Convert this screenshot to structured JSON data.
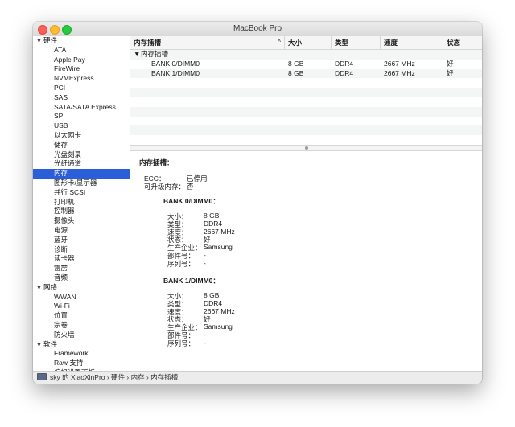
{
  "window": {
    "title": "MacBook Pro"
  },
  "sidebar": {
    "hardware": {
      "label": "硬件",
      "items": [
        "ATA",
        "Apple Pay",
        "FireWire",
        "NVMExpress",
        "PCI",
        "SAS",
        "SATA/SATA Express",
        "SPI",
        "USB",
        "以太网卡",
        "储存",
        "光盘刻录",
        "光纤通道",
        "内存",
        "图形卡/显示器",
        "并行 SCSI",
        "打印机",
        "控制器",
        "摄像头",
        "电源",
        "蓝牙",
        "诊断",
        "读卡器",
        "雷雳",
        "音频"
      ]
    },
    "network": {
      "label": "网络",
      "items": [
        "WWAN",
        "Wi-Fi",
        "位置",
        "宗卷",
        "防火墙"
      ]
    },
    "software": {
      "label": "软件",
      "items": [
        "Framework",
        "Raw 支持",
        "偏好设置面板"
      ]
    }
  },
  "table": {
    "headers": {
      "slot": "内存插槽",
      "size": "大小",
      "type": "类型",
      "speed": "速度",
      "status": "状态"
    },
    "group_label": "内存插槽",
    "rows": [
      {
        "slot": "BANK 0/DIMM0",
        "size": "8 GB",
        "type": "DDR4",
        "speed": "2667 MHz",
        "status": "好"
      },
      {
        "slot": "BANK 1/DIMM0",
        "size": "8 GB",
        "type": "DDR4",
        "speed": "2667 MHz",
        "status": "好"
      }
    ]
  },
  "detail": {
    "heading": "内存插槽：",
    "ecc_label": "ECC：",
    "ecc_value": "已停用",
    "upgradeable_label": "可升级内存：",
    "upgradeable_value": "否",
    "banks": [
      {
        "title": "BANK 0/DIMM0：",
        "fields": [
          {
            "label": "大小：",
            "value": "8 GB"
          },
          {
            "label": "类型：",
            "value": "DDR4"
          },
          {
            "label": "速度：",
            "value": "2667 MHz"
          },
          {
            "label": "状态：",
            "value": "好"
          },
          {
            "label": "生产企业：",
            "value": "Samsung"
          },
          {
            "label": "部件号：",
            "value": "-"
          },
          {
            "label": "序列号：",
            "value": "-"
          }
        ]
      },
      {
        "title": "BANK 1/DIMM0：",
        "fields": [
          {
            "label": "大小：",
            "value": "8 GB"
          },
          {
            "label": "类型：",
            "value": "DDR4"
          },
          {
            "label": "速度：",
            "value": "2667 MHz"
          },
          {
            "label": "状态：",
            "value": "好"
          },
          {
            "label": "生产企业：",
            "value": "Samsung"
          },
          {
            "label": "部件号：",
            "value": "-"
          },
          {
            "label": "序列号：",
            "value": "-"
          }
        ]
      }
    ]
  },
  "statusbar": {
    "path": "sky 的 XiaoXinPro › 硬件 › 内存 › 内存插槽"
  },
  "icons": {
    "disclosure": "disclosure-triangle-icon",
    "computer": "laptop-icon",
    "sort": "sort-chevron-icon"
  },
  "selected_sidebar_item": "内存",
  "colors": {
    "selection": "#2b5fd9",
    "close": "#fe5f57",
    "minimize": "#febc2e",
    "zoom": "#28c840"
  }
}
